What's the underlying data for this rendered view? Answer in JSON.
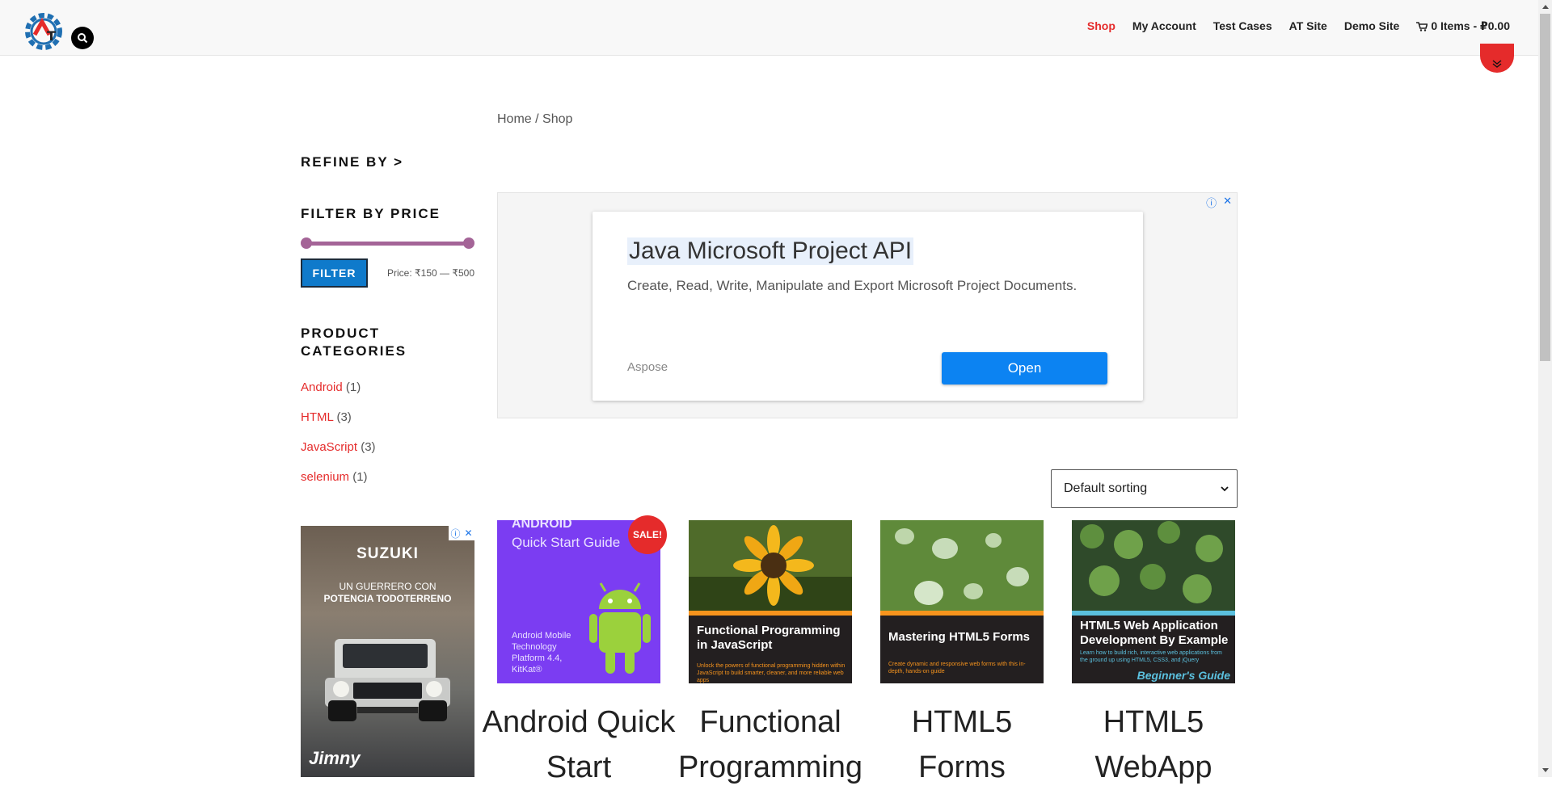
{
  "header": {
    "logo_letter": "T",
    "nav": [
      {
        "label": "Shop",
        "active": true
      },
      {
        "label": "My Account",
        "active": false
      },
      {
        "label": "Test Cases",
        "active": false
      },
      {
        "label": "AT Site",
        "active": false
      },
      {
        "label": "Demo Site",
        "active": false
      }
    ],
    "cart_label": "0 Items - ₽0.00",
    "accent_color": "#e52b2b"
  },
  "breadcrumb": "Home / Shop",
  "sidebar": {
    "refine_title": "REFINE BY >",
    "price_title": "FILTER BY PRICE",
    "filter_button": "FILTER",
    "price_label": "Price: ₹150 — ₹500",
    "categories_title": "PRODUCT CATEGORIES",
    "categories": [
      {
        "name": "Android",
        "count": "(1)"
      },
      {
        "name": "HTML",
        "count": "(3)"
      },
      {
        "name": "JavaScript",
        "count": "(3)"
      },
      {
        "name": "selenium",
        "count": "(1)"
      }
    ]
  },
  "side_ad": {
    "brand": "SUZUKI",
    "line1": "UN GUERRERO CON",
    "line2": "POTENCIA TODOTERRENO",
    "model": "Jimny"
  },
  "main_ad": {
    "headline": "Java Microsoft Project API",
    "description": "Create, Read, Write, Manipulate and Export Microsoft Project Documents.",
    "advertiser": "Aspose",
    "button": "Open"
  },
  "sorting": {
    "selected": "Default sorting"
  },
  "products": [
    {
      "title": "Android Quick Start",
      "sale_badge": "SALE!",
      "cover_lines": [
        "ANDROID",
        "Quick Start Guide",
        "Android Mobile Technology Platform 4.4, KitKat®"
      ]
    },
    {
      "title": "Functional Programming",
      "cover_title": "Functional Programming in JavaScript",
      "cover_sub": "Unlock the powers of functional programming hidden within JavaScript to build smarter, cleaner, and more reliable web apps"
    },
    {
      "title": "HTML5 Forms",
      "cover_title": "Mastering HTML5 Forms",
      "cover_sub": "Create dynamic and responsive web forms with this in-depth, hands-on guide"
    },
    {
      "title": "HTML5 WebApp",
      "cover_title": "HTML5 Web Application Development By Example",
      "cover_sub": "Learn how to build rich, interactive web applications from the ground up using HTML5, CSS3, and jQuery",
      "cover_guide": "Beginner's Guide"
    }
  ]
}
